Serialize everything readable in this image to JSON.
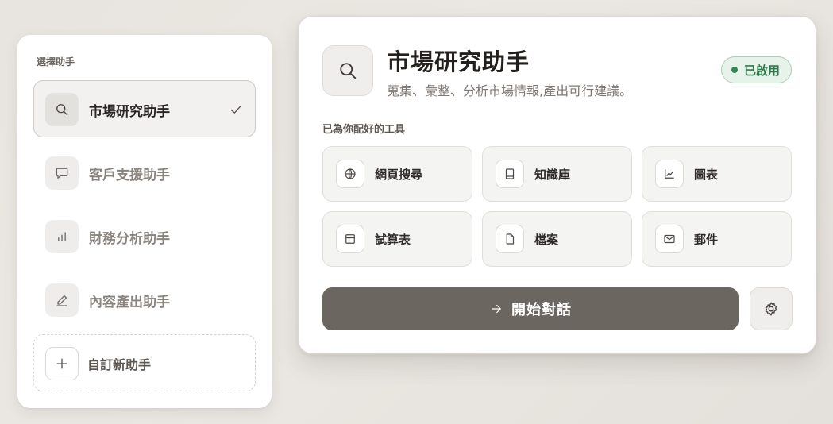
{
  "selector": {
    "heading": "選擇助手",
    "items": [
      {
        "label": "市場研究助手",
        "icon": "search-icon",
        "selected": true
      },
      {
        "label": "客戶支援助手",
        "icon": "chat-bubble-icon",
        "selected": false
      },
      {
        "label": "財務分析助手",
        "icon": "bar-chart-icon",
        "selected": false
      },
      {
        "label": "內容產出助手",
        "icon": "pen-icon",
        "selected": false
      }
    ],
    "custom": {
      "label": "自訂新助手",
      "icon": "plus-icon"
    }
  },
  "detail": {
    "icon": "search-icon",
    "title": "市場研究助手",
    "subtitle": "蒐集、彙整、分析市場情報,產出可行建議。",
    "status": "已啟用",
    "tools_heading": "已為你配好的工具",
    "tools": [
      {
        "label": "網頁搜尋",
        "icon": "globe-icon"
      },
      {
        "label": "知識庫",
        "icon": "book-icon"
      },
      {
        "label": "圖表",
        "icon": "line-chart-icon"
      },
      {
        "label": "試算表",
        "icon": "spreadsheet-icon"
      },
      {
        "label": "檔案",
        "icon": "file-icon"
      },
      {
        "label": "郵件",
        "icon": "mail-icon"
      }
    ],
    "start_label": "開始對話",
    "start_icon": "arrow-right-icon",
    "settings_icon": "gear-icon"
  },
  "colors": {
    "accent": "#6c6660",
    "status_green": "#2f7a4a",
    "status_bg": "#e6f2ea"
  }
}
